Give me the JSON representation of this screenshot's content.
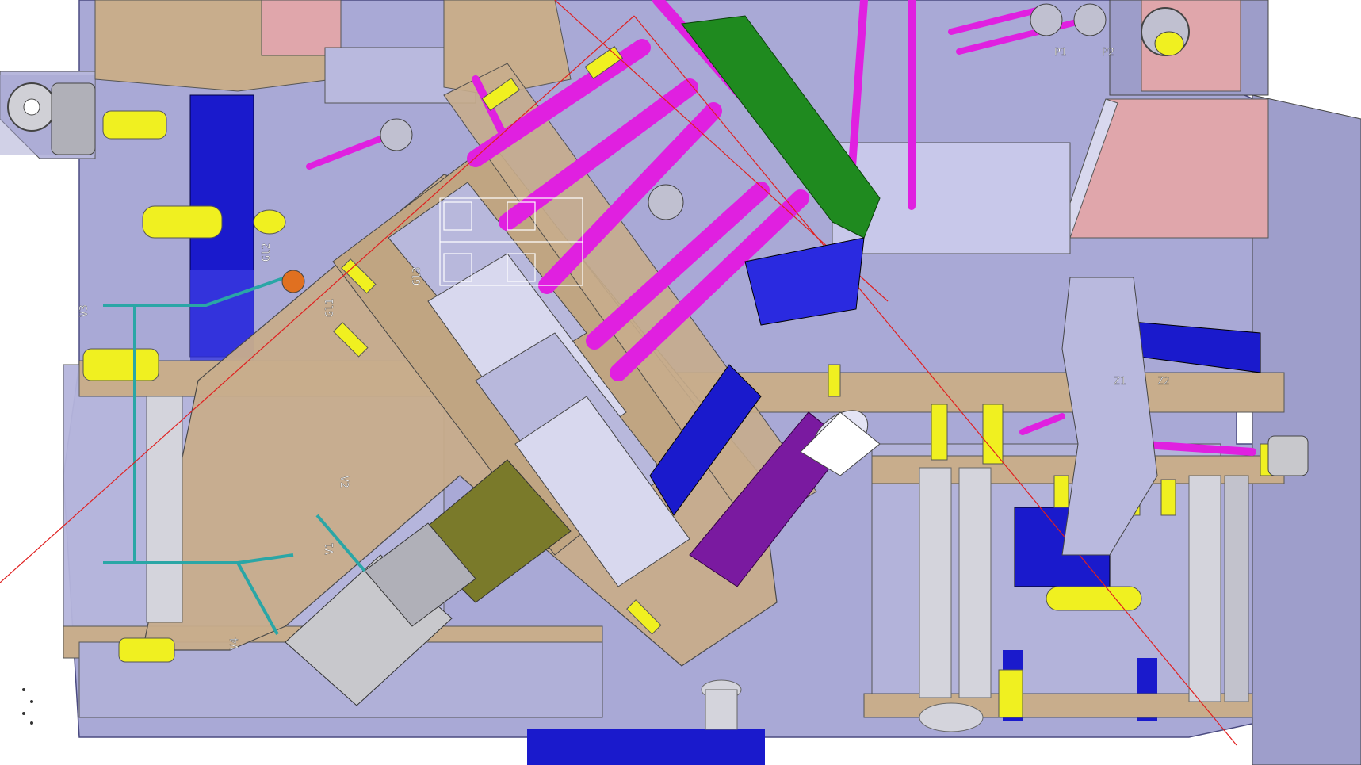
{
  "viewport": {
    "background": "#ffffff",
    "colors": {
      "plate": "#a9a9d6",
      "plate_dark": "#8f8fbf",
      "wood": "#c8ad8c",
      "pink_block": "#e0a6ab",
      "magenta": "#e020e0",
      "blue": "#1a1acc",
      "yellow": "#f0f020",
      "green": "#1f8a1f",
      "cyan": "#2aa6a6",
      "purple": "#7a1aa0",
      "olive": "#7a7a2a",
      "silver": "#c8c8cc",
      "red_line": "#e02020"
    }
  },
  "labels": [
    {
      "id": "label-1",
      "text": "Gl2"
    },
    {
      "id": "label-2",
      "text": "Gl1"
    },
    {
      "id": "label-3",
      "text": "Gl3"
    },
    {
      "id": "label-4",
      "text": "V1"
    },
    {
      "id": "label-5",
      "text": "V2"
    },
    {
      "id": "label-6",
      "text": "V3"
    },
    {
      "id": "label-7",
      "text": "V4"
    },
    {
      "id": "label-8",
      "text": "P1"
    },
    {
      "id": "label-9",
      "text": "P2"
    },
    {
      "id": "label-10",
      "text": "Z1"
    },
    {
      "id": "label-11",
      "text": "Z2"
    }
  ]
}
